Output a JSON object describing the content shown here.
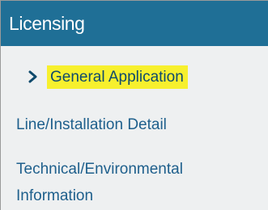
{
  "panel": {
    "title": "Licensing"
  },
  "nav": {
    "items": [
      {
        "label": "General Application",
        "active": true
      },
      {
        "label": "Line/Installation Detail",
        "active": false
      },
      {
        "label": "Technical/Environmental Information",
        "active": false
      }
    ]
  },
  "colors": {
    "header_bg": "#1f6f96",
    "panel_bg": "#eef0f1",
    "link_text": "#1e5f8c",
    "highlight": "#f7f02e"
  },
  "icons": {
    "active_indicator": "chevron-right-icon"
  }
}
